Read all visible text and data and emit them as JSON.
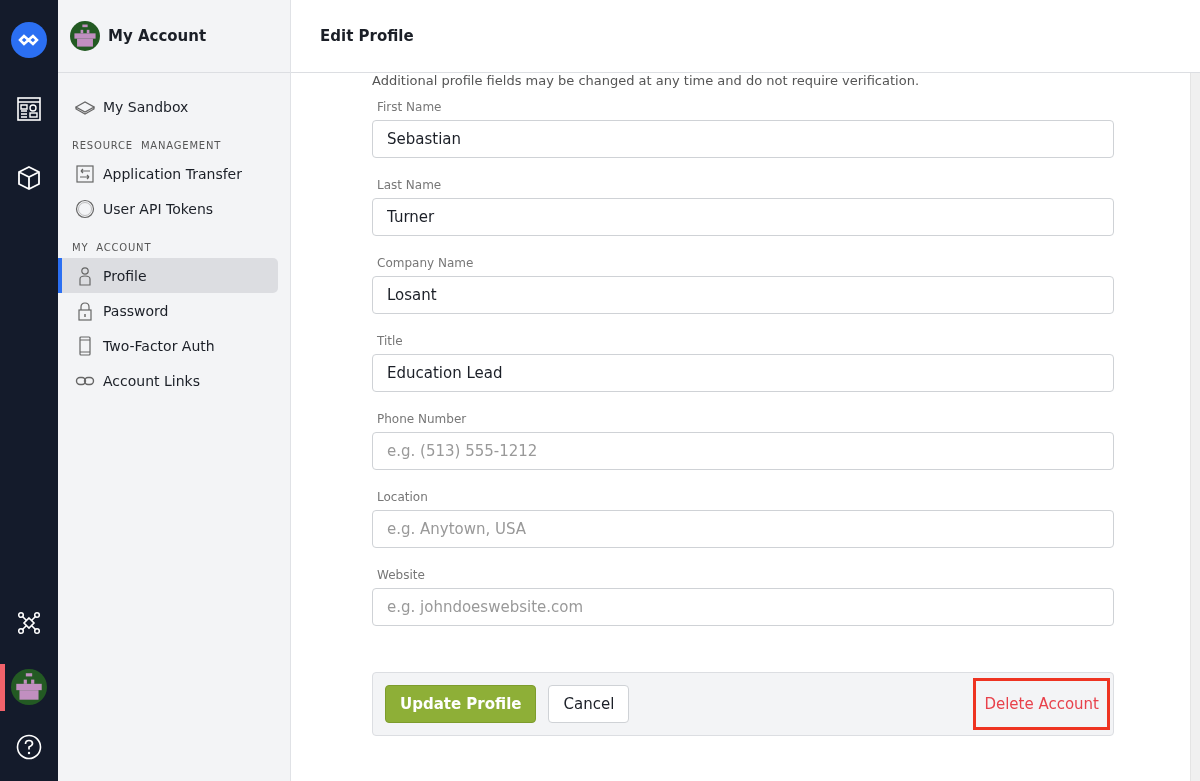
{
  "sidebar": {
    "title": "My Account",
    "top_items": [
      {
        "label": "My Sandbox",
        "selected": false
      }
    ],
    "sections": [
      {
        "heading": "RESOURCE  MANAGEMENT",
        "items": [
          {
            "label": "Application Transfer",
            "selected": false
          },
          {
            "label": "User API Tokens",
            "selected": false
          }
        ]
      },
      {
        "heading": "MY  ACCOUNT",
        "items": [
          {
            "label": "Profile",
            "selected": true
          },
          {
            "label": "Password",
            "selected": false
          },
          {
            "label": "Two-Factor Auth",
            "selected": false
          },
          {
            "label": "Account Links",
            "selected": false
          }
        ]
      }
    ]
  },
  "header": {
    "title": "Edit Profile"
  },
  "note": "Additional profile fields may be changed at any time and do not require verification.",
  "fields": [
    {
      "label": "First Name",
      "value": "Sebastian"
    },
    {
      "label": "Last Name",
      "value": "Turner"
    },
    {
      "label": "Company Name",
      "value": "Losant"
    },
    {
      "label": "Title",
      "value": "Education Lead"
    },
    {
      "label": "Phone Number",
      "placeholder": "e.g. (513) 555-1212"
    },
    {
      "label": "Location",
      "placeholder": "e.g. Anytown, USA"
    },
    {
      "label": "Website",
      "placeholder": "e.g. johndoeswebsite.com"
    }
  ],
  "actions": {
    "primary": "Update Profile",
    "cancel": "Cancel",
    "delete": "Delete Account",
    "delete_highlighted": true
  }
}
